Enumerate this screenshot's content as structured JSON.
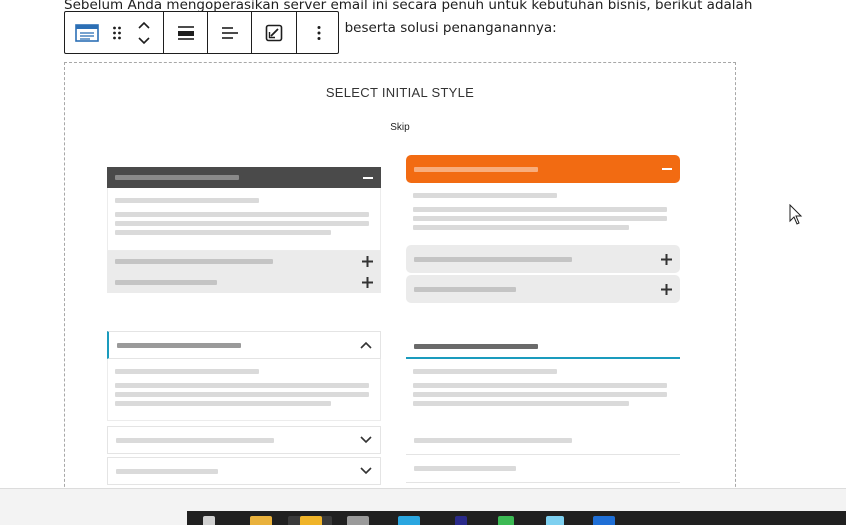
{
  "paragraph": {
    "line1": "Sebelum Anda mengoperasikan server email ini secara penuh untuk kebutuhan bisnis, berikut adalah",
    "line2": "ncul beserta solusi penanganannya:"
  },
  "toolbar": {
    "buttons": [
      "block-type",
      "drag",
      "move-up",
      "move-down",
      "align",
      "text-align",
      "style",
      "options"
    ]
  },
  "placeholder": {
    "title": "SELECT INITIAL STYLE",
    "skip": "Skip"
  },
  "styles": [
    "dark-header-accordion",
    "orange-rounded-accordion",
    "outlined-chevron-accordion",
    "underlined-tab-accordion"
  ],
  "colors": {
    "accent_orange": "#f26b12",
    "accent_teal": "#1a9bbd",
    "dark_header": "#4a4a4a"
  }
}
